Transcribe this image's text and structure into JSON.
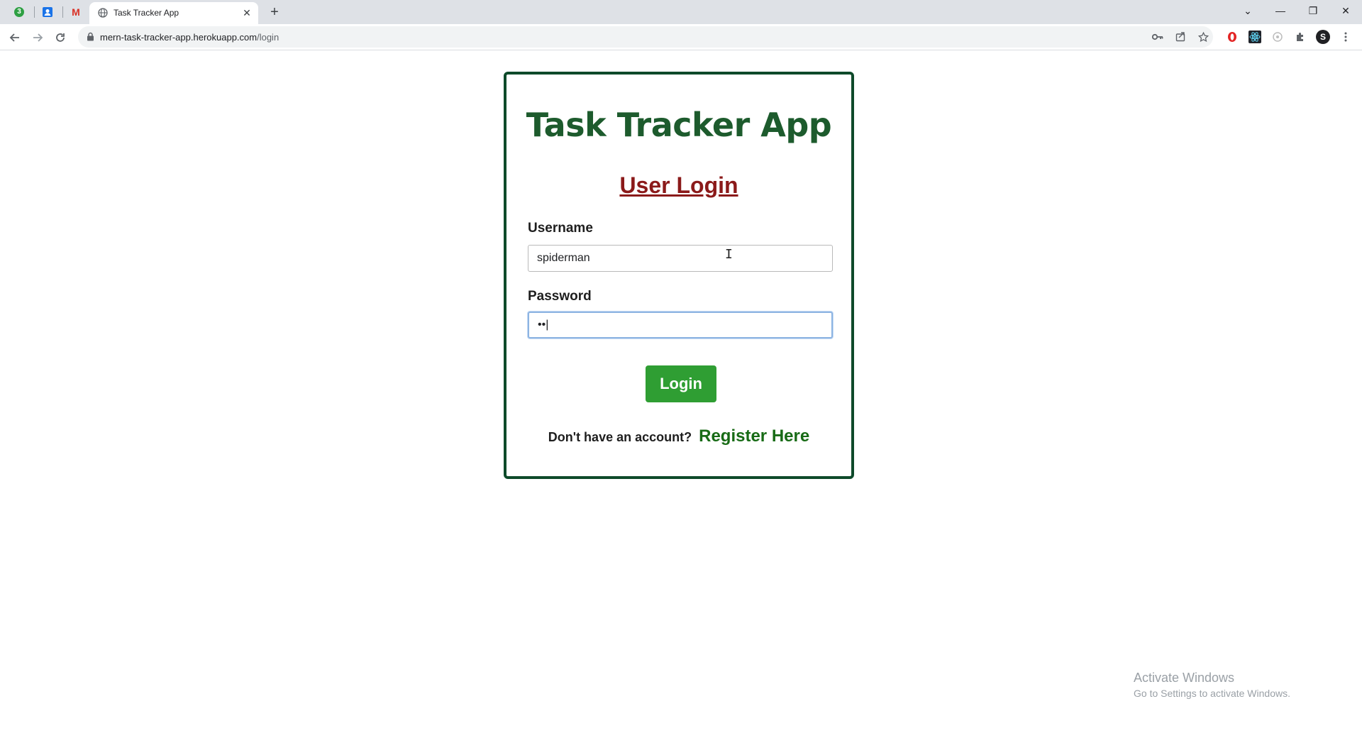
{
  "browser": {
    "pinned_tabs": [
      {
        "icon": "badge-3-icon",
        "label": "3"
      },
      {
        "icon": "contacts-icon"
      },
      {
        "icon": "gmail-icon",
        "label": "M"
      }
    ],
    "active_tab": {
      "title": "Task Tracker App",
      "icon": "globe-icon",
      "close_glyph": "✕"
    },
    "new_tab_glyph": "+",
    "url_host": "mern-task-tracker-app.herokuapp.com",
    "url_path": "/login",
    "window_controls": {
      "dropdown": "⌄",
      "minimize": "—",
      "restore": "❐",
      "close": "✕"
    },
    "profile_letter": "S"
  },
  "page": {
    "app_title": "Task Tracker App",
    "login_heading": "User Login",
    "username_label": "Username",
    "username_value": "spiderman",
    "password_label": "Password",
    "password_value": "••",
    "login_button": "Login",
    "register_question": "Don't have an account?",
    "register_link": "Register Here"
  },
  "watermark": {
    "line1": "Activate Windows",
    "line2": "Go to Settings to activate Windows."
  },
  "colors": {
    "card_border": "#0e4a2a",
    "title": "#1d5b2d",
    "heading": "#8b1a1a",
    "button": "#2f9e33",
    "link": "#186b16"
  }
}
